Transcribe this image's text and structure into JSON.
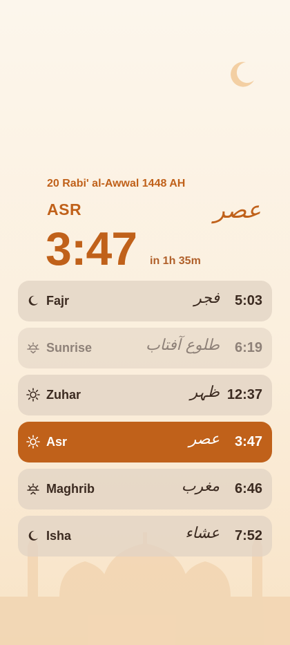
{
  "header": {
    "hijri_date": "20 Rabi' al-Awwal 1448 AH",
    "current_prayer": "ASR",
    "current_prayer_arabic": "عصر",
    "current_time": "3:47",
    "countdown": "in 1h 35m"
  },
  "colors": {
    "accent": "#c0611a",
    "row_bg": "#e2d4c4",
    "text": "#3b2a20"
  },
  "prayers": [
    {
      "name": "Fajr",
      "arabic": "فجر",
      "time": "5:03",
      "icon": "moon-icon",
      "state": "normal"
    },
    {
      "name": "Sunrise",
      "arabic": "طلوع آفتاب",
      "time": "6:19",
      "icon": "sunrise-icon",
      "state": "dim"
    },
    {
      "name": "Zuhar",
      "arabic": "ظہر",
      "time": "12:37",
      "icon": "sun-icon",
      "state": "normal"
    },
    {
      "name": "Asr",
      "arabic": "عصر",
      "time": "3:47",
      "icon": "sun-icon",
      "state": "active"
    },
    {
      "name": "Maghrib",
      "arabic": "مغرب",
      "time": "6:46",
      "icon": "sunset-icon",
      "state": "normal"
    },
    {
      "name": "Isha",
      "arabic": "عشاء",
      "time": "7:52",
      "icon": "moon-icon",
      "state": "normal"
    }
  ]
}
